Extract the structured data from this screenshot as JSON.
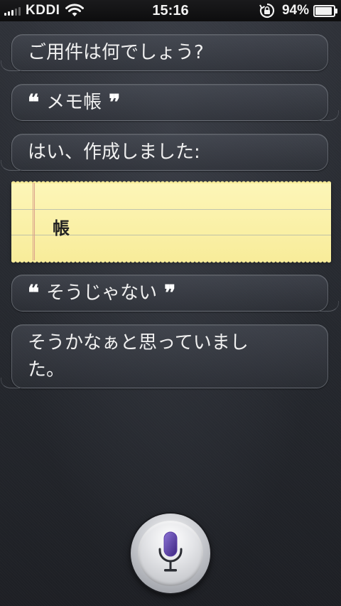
{
  "status_bar": {
    "carrier": "KDDI",
    "time": "15:16",
    "battery_percent": "94%",
    "battery_level": 0.94,
    "icons": [
      "signal-bars-icon",
      "wifi-icon",
      "rotation-lock-icon",
      "battery-icon"
    ]
  },
  "conversation": {
    "siri_prompt": "ご用件は何でしょう?",
    "user_query_1": "メモ帳",
    "siri_reply_1": "はい、作成しました:",
    "note_text": "帳",
    "user_query_2": "そうじゃない",
    "siri_reply_2": "そうかなぁと思っていました。",
    "quote_open": "❝",
    "quote_close": "❞"
  },
  "mic": {
    "icon": "microphone-icon",
    "accent_color": "#5b3fa6"
  }
}
